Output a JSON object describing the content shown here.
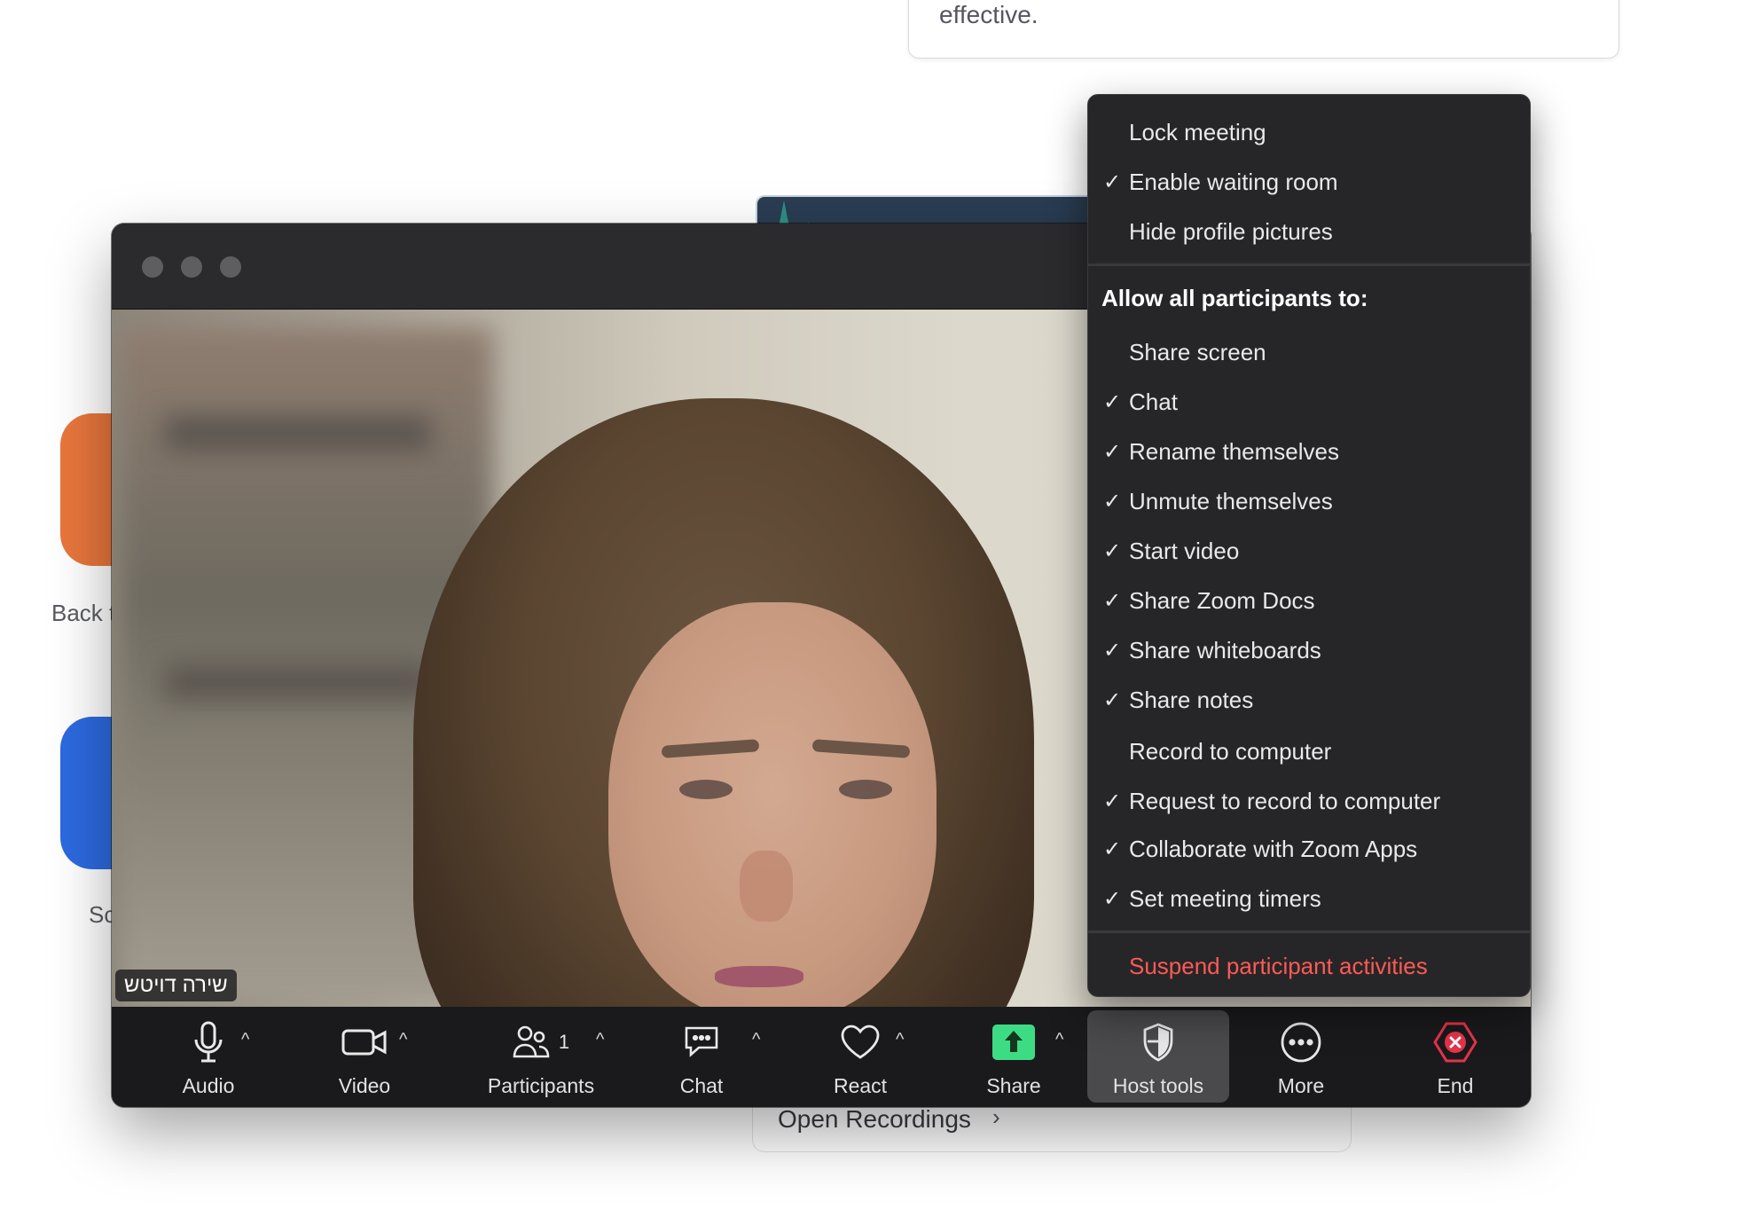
{
  "background": {
    "card_text": "effective.",
    "tile_label_1": "Back t",
    "tile_label_2": "Sc",
    "recordings_link": "Open Recordings",
    "recordings_chevron": "›"
  },
  "meeting": {
    "participant_name": "שירה דויטש",
    "participants_count": "1"
  },
  "toolbar": {
    "audio": "Audio",
    "video": "Video",
    "participants": "Participants",
    "chat": "Chat",
    "react": "React",
    "share": "Share",
    "host_tools": "Host tools",
    "more": "More",
    "end": "End",
    "caret": "^"
  },
  "host_menu": {
    "section_header": "Allow all participants to:",
    "top_items": [
      {
        "label": "Lock meeting",
        "checked": false
      },
      {
        "label": "Enable waiting room",
        "checked": true
      },
      {
        "label": "Hide profile pictures",
        "checked": false
      }
    ],
    "allow_items": [
      {
        "label": "Share screen",
        "checked": false
      },
      {
        "label": "Chat",
        "checked": true
      },
      {
        "label": "Rename themselves",
        "checked": true
      },
      {
        "label": "Unmute themselves",
        "checked": true
      },
      {
        "label": "Start video",
        "checked": true
      },
      {
        "label": "Share Zoom Docs",
        "checked": true
      },
      {
        "label": "Share whiteboards",
        "checked": true
      },
      {
        "label": "Share notes",
        "checked": true
      },
      {
        "label": "Record to computer",
        "checked": false
      },
      {
        "label": "Request to record to computer",
        "checked": true
      },
      {
        "label": "Collaborate with Zoom Apps",
        "checked": true
      },
      {
        "label": "Set meeting timers",
        "checked": true
      }
    ],
    "danger_item": "Suspend participant activities",
    "check_glyph": "✓"
  },
  "colors": {
    "share_green": "#3ddc84",
    "end_red": "#e5334a",
    "danger_text": "#ff5a55"
  }
}
